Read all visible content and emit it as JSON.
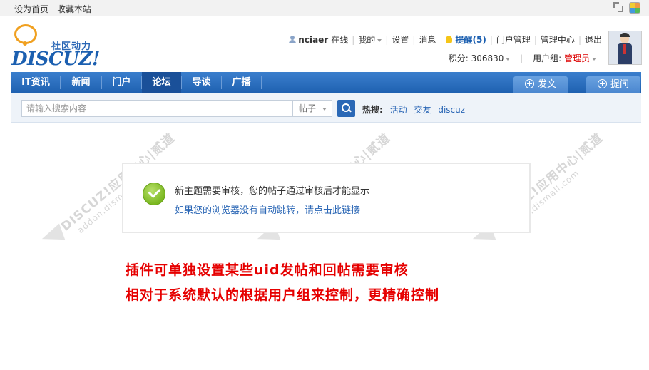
{
  "topbar": {
    "set_homepage": "设为首页",
    "bookmark": "收藏本站"
  },
  "logo": {
    "tagline": "社区动力",
    "wordmark": "DISCUZ!"
  },
  "user": {
    "username": "nciaer",
    "status": "在线",
    "my": "我的",
    "settings": "设置",
    "messages": "消息",
    "remind": "提醒(5)",
    "portal_manage": "门户管理",
    "admin_center": "管理中心",
    "logout": "退出",
    "credits": "积分: 306830",
    "usergroup_label": "用户组:",
    "usergroup": "管理员"
  },
  "nav": {
    "items": [
      {
        "label": "IT资讯"
      },
      {
        "label": "新闻"
      },
      {
        "label": "门户"
      },
      {
        "label": "论坛"
      },
      {
        "label": "导读"
      },
      {
        "label": "广播"
      }
    ],
    "active_index": 3,
    "post_button": "发文",
    "ask_button": "提间"
  },
  "search": {
    "placeholder": "请输入搜索内容",
    "type_selected": "帖子",
    "hot_label": "热搜:",
    "hot_terms": [
      "活动",
      "交友",
      "discuz"
    ]
  },
  "message": {
    "main": "新主题需要审核，您的帖子通过审核后才能显示",
    "link": "如果您的浏览器没有自动跳转，请点击此链接"
  },
  "watermark": {
    "line1": "DISCUZ!应用中心|贰道",
    "line2": "addon.dismall.com"
  },
  "annotation": {
    "line1": "插件可单独设置某些uid发帖和回帖需要审核",
    "line2": "相对于系统默认的根据用户组来控制，更精确控制"
  },
  "colors": {
    "brand_blue": "#1e60b0",
    "link_blue": "#2a66b5",
    "alert_red": "#e60000",
    "success_green": "#7bb821"
  }
}
